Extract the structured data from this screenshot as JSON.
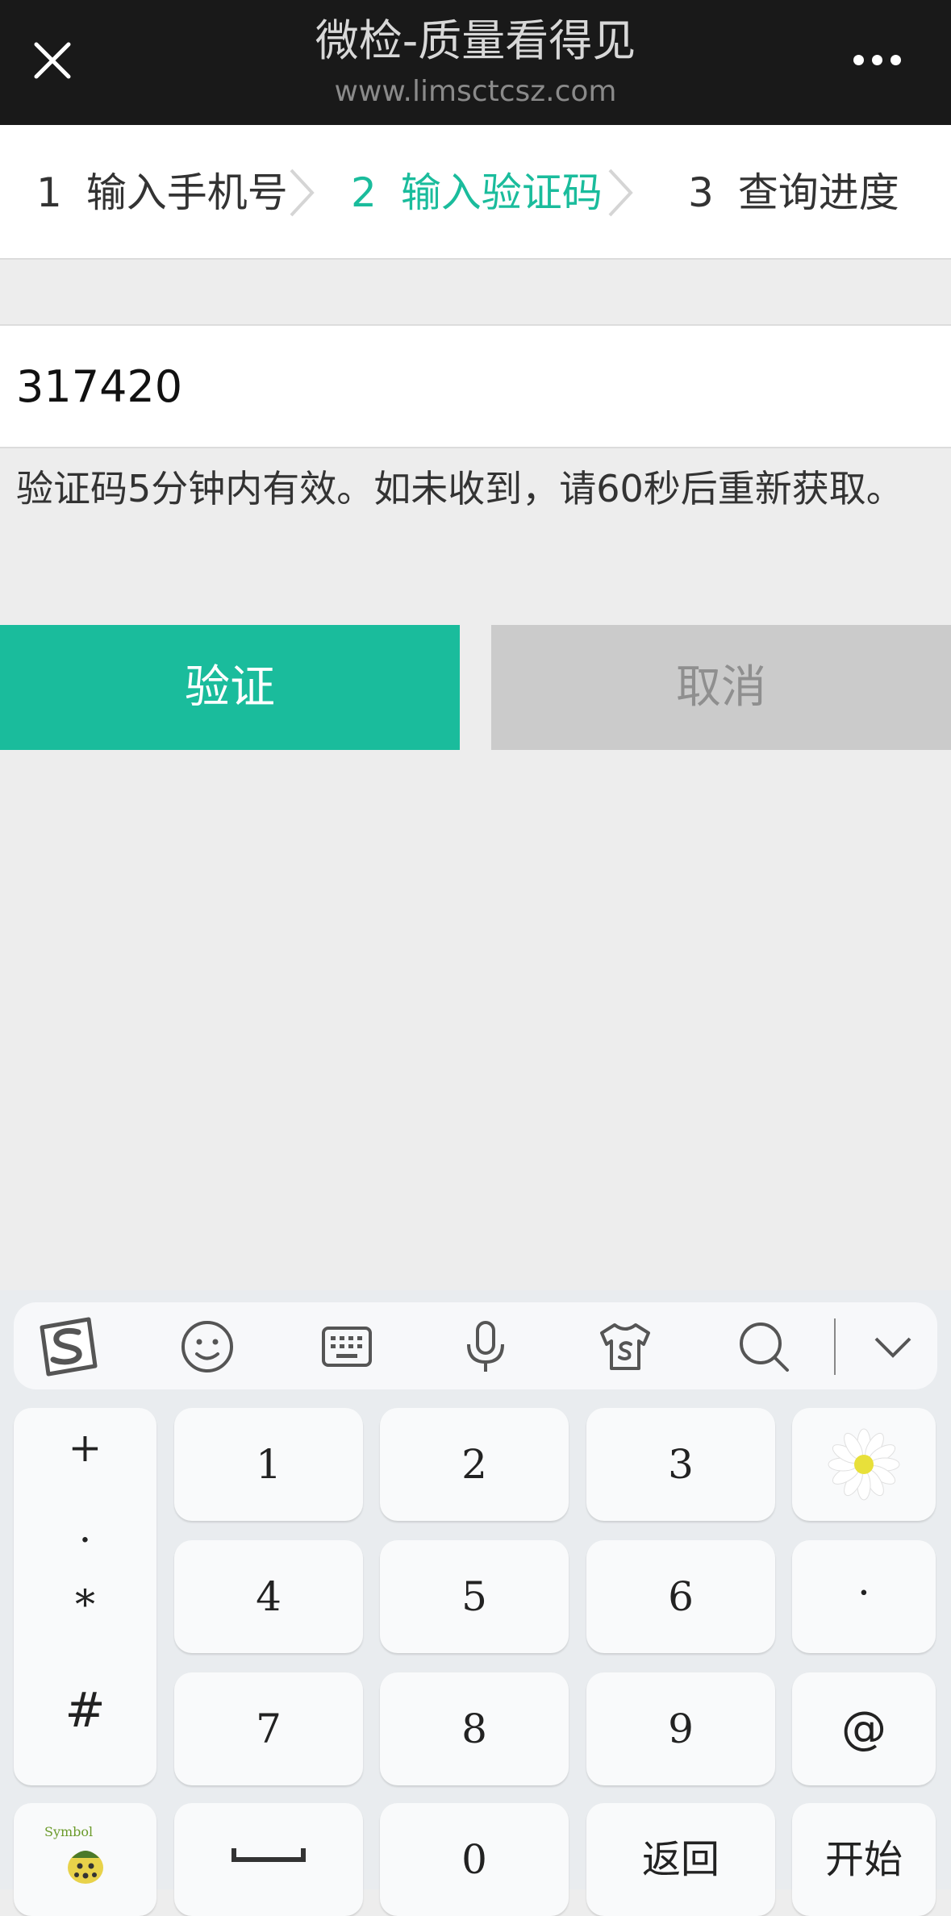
{
  "header": {
    "title": "微检-质量看得见",
    "url": "www.limsctcsz.com",
    "close_icon": "close-icon",
    "more_icon": "more-icon"
  },
  "steps": [
    {
      "num": "1",
      "label": "输入手机号"
    },
    {
      "num": "2",
      "label": "输入验证码"
    },
    {
      "num": "3",
      "label": "查询进度"
    }
  ],
  "form": {
    "code_value": "317420",
    "hint": "验证码5分钟内有效。如未收到，请60秒后重新获取。",
    "verify_label": "验证",
    "cancel_label": "取消"
  },
  "colors": {
    "accent": "#1abc9c",
    "topbar": "#191919",
    "background": "#ededed",
    "cancel_bg": "#cbcbcb"
  },
  "keyboard": {
    "toolbar_icons": [
      "sogou-logo-icon",
      "emoji-icon",
      "keyboard-icon",
      "microphone-icon",
      "skin-icon",
      "search-icon",
      "collapse-icon"
    ],
    "symbols": [
      "+",
      ".",
      "*",
      "#"
    ],
    "digits": [
      "1",
      "2",
      "3",
      "4",
      "5",
      "6",
      "7",
      "8",
      "9",
      "0"
    ],
    "dot_key": "·",
    "at_key": "@",
    "symbol_label": "Symbol",
    "space_icon": "space-icon",
    "back_label": "返回",
    "start_label": "开始",
    "flower_icon": "daisy-icon"
  }
}
